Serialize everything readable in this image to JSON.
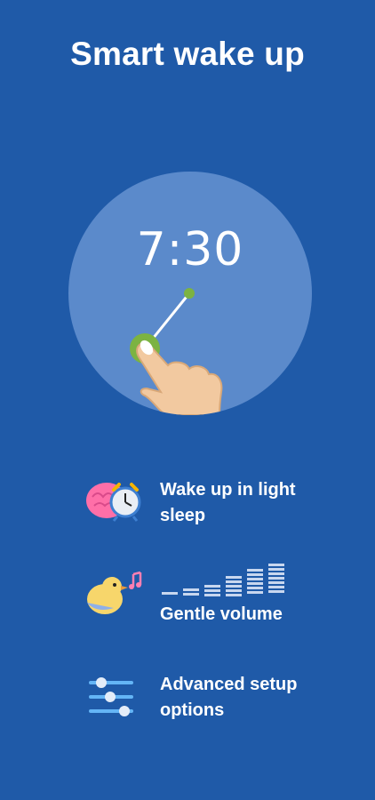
{
  "header": {
    "title": "Smart wake up"
  },
  "dial": {
    "time": "7:30"
  },
  "features": [
    {
      "label": "Wake up in light sleep",
      "line1": "Wake up in light",
      "line2": "sleep",
      "icon": "brain-alarm-clock-icon"
    },
    {
      "label": "Gentle volume",
      "line1": "Gentle volume",
      "icon": "bird-music-icon",
      "volume_levels": 6
    },
    {
      "label": "Advanced setup options",
      "line1": "Advanced setup",
      "line2": "options",
      "icon": "sliders-icon"
    }
  ],
  "colors": {
    "background": "#1f5aa8",
    "dial": "#5b8acb",
    "accent_green": "#7cb342"
  }
}
